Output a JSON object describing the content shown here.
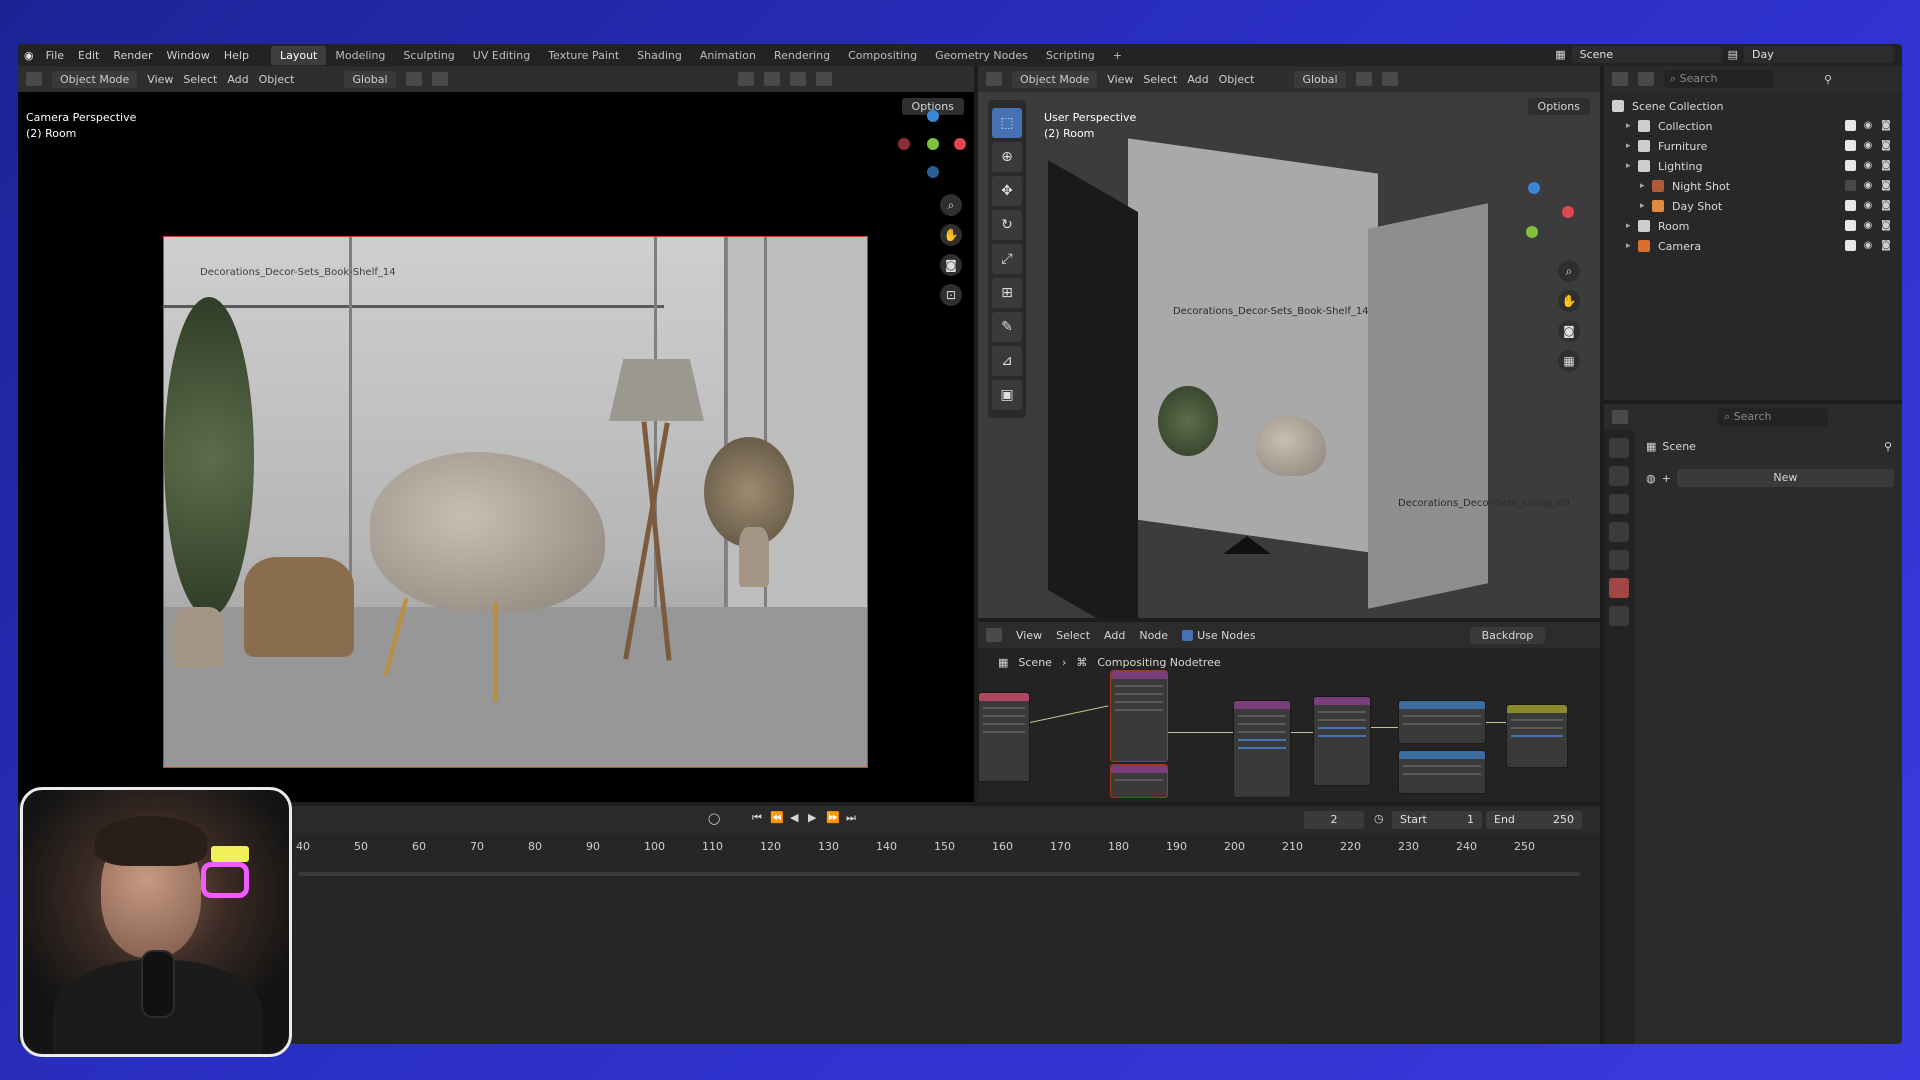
{
  "topbar": {
    "menu": [
      "File",
      "Edit",
      "Render",
      "Window",
      "Help"
    ],
    "workspaces": [
      "Layout",
      "Modeling",
      "Sculpting",
      "UV Editing",
      "Texture Paint",
      "Shading",
      "Animation",
      "Rendering",
      "Compositing",
      "Geometry Nodes",
      "Scripting"
    ],
    "active_workspace": "Layout",
    "add_tab": "+",
    "scene": "Scene",
    "view_layer": "Day"
  },
  "left_viewport": {
    "mode": "Object Mode",
    "menus": [
      "View",
      "Select",
      "Add",
      "Object"
    ],
    "orientation": "Global",
    "options": "Options",
    "view_name": "Camera Perspective",
    "collection": "(2) Room",
    "object_label": "Decorations_Decor-Sets_Book-Shelf_14",
    "gizmo": {
      "x": "X",
      "y": "Y",
      "z": "Z"
    }
  },
  "right_viewport": {
    "mode": "Object Mode",
    "menus": [
      "View",
      "Select",
      "Add",
      "Object"
    ],
    "orientation": "Global",
    "options": "Options",
    "view_name": "User Perspective",
    "collection": "(2) Room",
    "object_label": "Decorations_Decor-Sets_Book-Shelf_14",
    "object_label_2": "Decorations_Decor-Sets_Living_09"
  },
  "node_editor": {
    "menus": [
      "View",
      "Select",
      "Add",
      "Node"
    ],
    "use_nodes": "Use Nodes",
    "backdrop": "Backdrop",
    "breadcrumb_scene": "Scene",
    "breadcrumb_tree": "Compositing Nodetree"
  },
  "timeline": {
    "current_frame": "2",
    "start_label": "Start",
    "start_value": "1",
    "end_label": "End",
    "end_value": "250",
    "ticks": [
      "40",
      "50",
      "60",
      "70",
      "80",
      "90",
      "100",
      "110",
      "120",
      "130",
      "140",
      "150",
      "160",
      "170",
      "180",
      "190",
      "200",
      "210",
      "220",
      "230",
      "240",
      "250"
    ]
  },
  "outliner": {
    "search_placeholder": "Search",
    "root": "Scene Collection",
    "items": [
      {
        "label": "Collection",
        "indent": 1
      },
      {
        "label": "Furniture",
        "indent": 1
      },
      {
        "label": "Lighting",
        "indent": 1
      },
      {
        "label": "Night Shot",
        "indent": 2
      },
      {
        "label": "Day Shot",
        "indent": 2
      },
      {
        "label": "Room",
        "indent": 1
      },
      {
        "label": "Camera",
        "indent": 1
      }
    ]
  },
  "properties": {
    "search_placeholder": "Search",
    "scene_label": "Scene",
    "new_button": "New"
  },
  "colors": {
    "accent_blue": "#4672b5",
    "x_axis": "#e0474c",
    "y_axis": "#7fc13a",
    "z_axis": "#3b86d6",
    "camera_frame": "#c4451f"
  }
}
